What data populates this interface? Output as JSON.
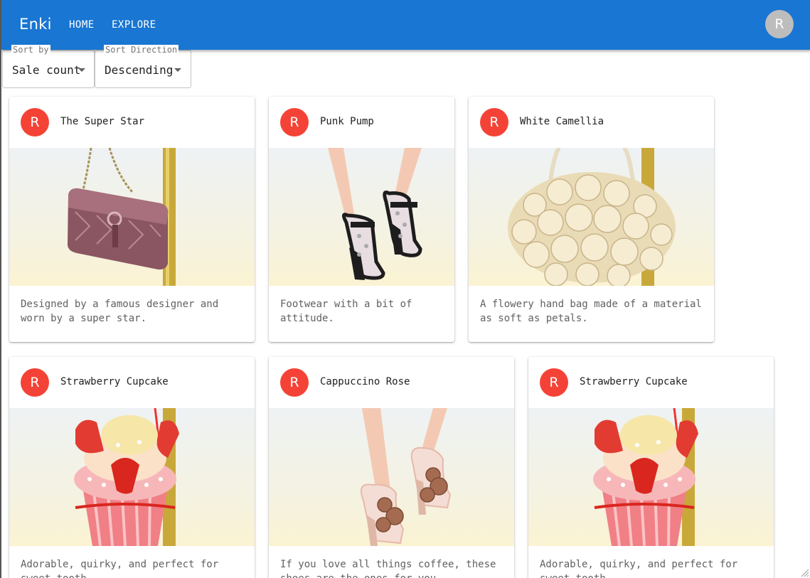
{
  "app": {
    "title": "Enki",
    "avatar_letter": "R"
  },
  "nav": {
    "home": "HOME",
    "explore": "EXPLORE"
  },
  "sort": {
    "by_label": "Sort by",
    "by_value": "Sale count",
    "dir_label": "Sort Direction",
    "dir_value": "Descending"
  },
  "products": [
    {
      "avatar": "R",
      "title": "The Super Star",
      "description": "Designed by a famous designer and worn by a super star.",
      "image": "clutch-bag-image"
    },
    {
      "avatar": "R",
      "title": "Punk Pump",
      "description": "Footwear with a bit of attitude.",
      "image": "spiked-heels-image"
    },
    {
      "avatar": "R",
      "title": "White Camellia",
      "description": "A flowery hand bag made of a material as soft as petals.",
      "image": "flower-bag-image"
    },
    {
      "avatar": "R",
      "title": "Strawberry Cupcake",
      "description": "Adorable, quirky, and perfect for sweet tooth.",
      "image": "cupcake-bag-image"
    },
    {
      "avatar": "R",
      "title": "Cappuccino Rose",
      "description": "If you love all things coffee, these shoes are the ones for you.",
      "image": "rose-heels-image"
    },
    {
      "avatar": "R",
      "title": "Strawberry Cupcake",
      "description": "Adorable, quirky, and perfect for sweet tooth.",
      "image": "cupcake-bag-image"
    }
  ],
  "colors": {
    "appbar": "#1976d2",
    "card_avatar": "#f44336",
    "user_avatar": "#bdbdbd"
  }
}
